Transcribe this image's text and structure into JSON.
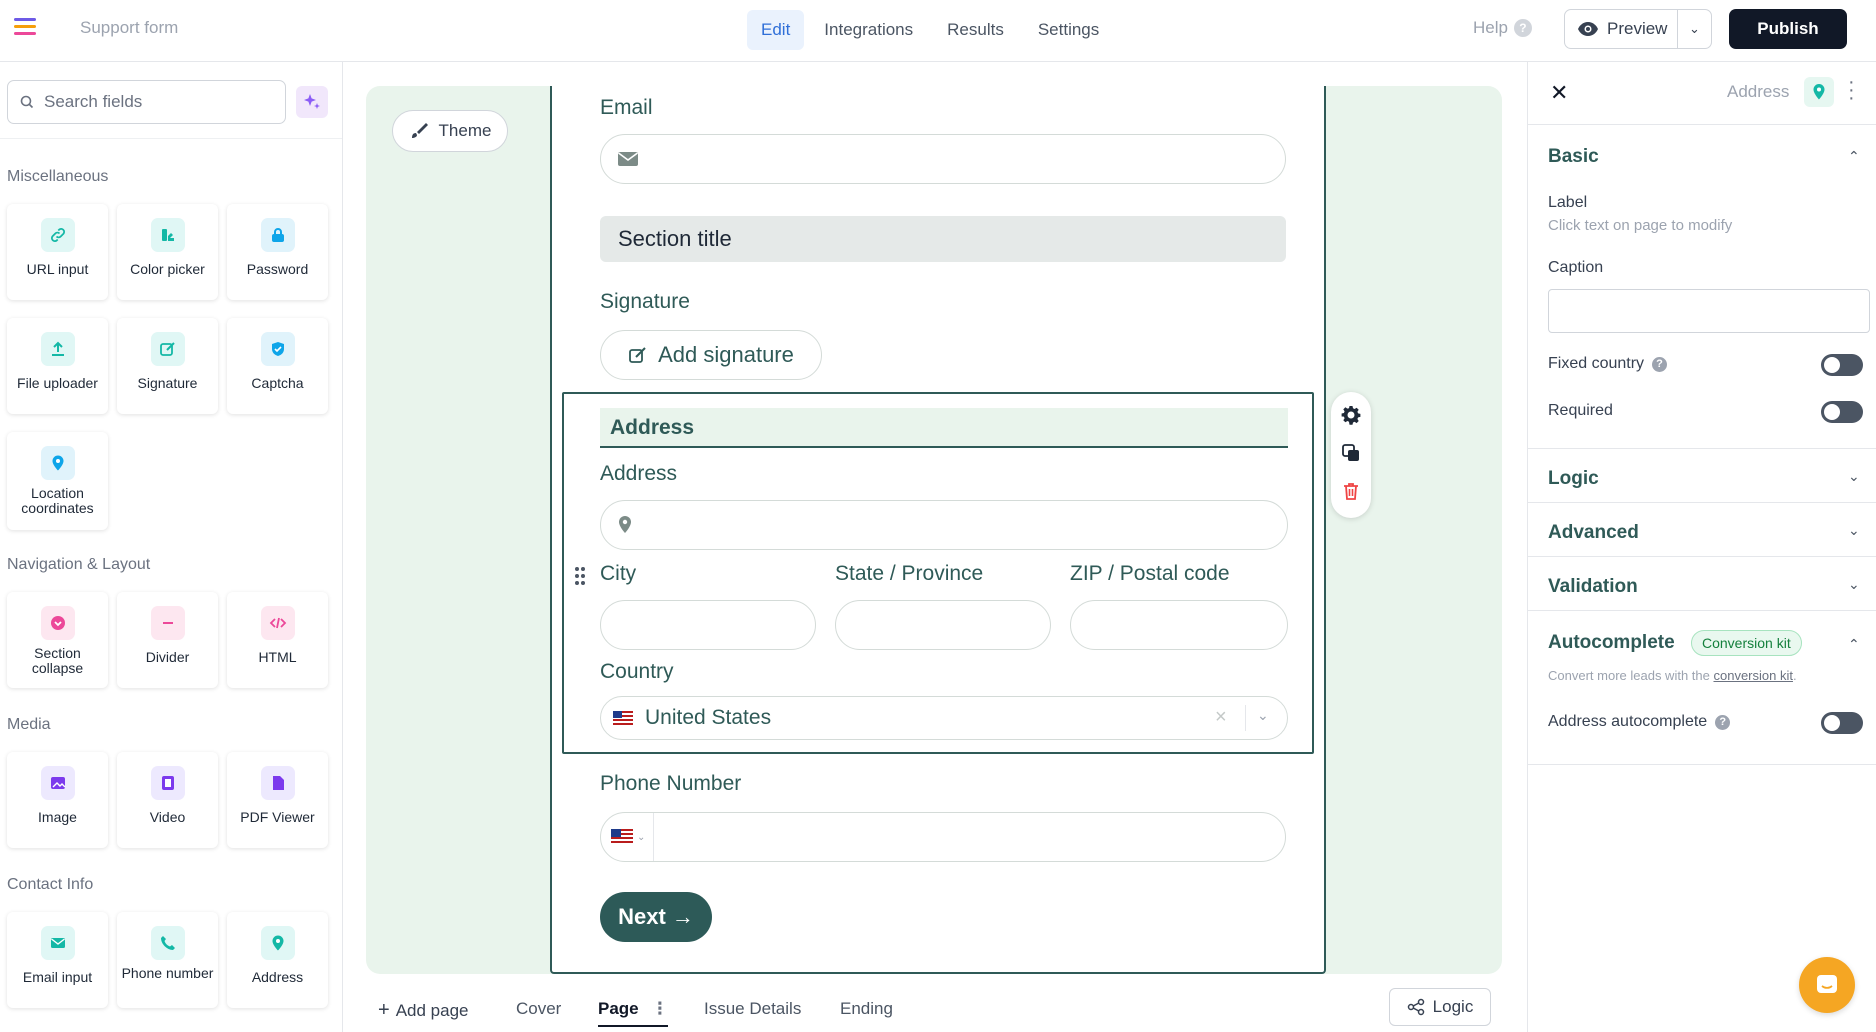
{
  "header": {
    "app_title": "Support form",
    "tabs": [
      {
        "label": "Edit",
        "active": true
      },
      {
        "label": "Integrations"
      },
      {
        "label": "Results"
      },
      {
        "label": "Settings"
      }
    ],
    "help_label": "Help",
    "preview_label": "Preview",
    "publish_label": "Publish"
  },
  "sidebar": {
    "search_placeholder": "Search fields",
    "categories": {
      "misc": "Miscellaneous",
      "nav": "Navigation & Layout",
      "media": "Media",
      "contact": "Contact Info"
    },
    "misc_items": [
      "URL input",
      "Color picker",
      "Password",
      "File uploader",
      "Signature",
      "Captcha",
      "Location coordinates"
    ],
    "nav_items": [
      "Section collapse",
      "Divider",
      "HTML"
    ],
    "media_items": [
      "Image",
      "Video",
      "PDF Viewer"
    ],
    "contact_items": [
      "Email input",
      "Phone number",
      "Address"
    ]
  },
  "canvas": {
    "theme_label": "Theme",
    "email_label": "Email",
    "section_title": "Section title",
    "signature_label": "Signature",
    "add_signature": "Add signature",
    "address_block_title": "Address",
    "address_label": "Address",
    "city_label": "City",
    "state_label": "State / Province",
    "zip_label": "ZIP / Postal code",
    "country_label": "Country",
    "country_value": "United States",
    "phone_label": "Phone Number",
    "next_label": "Next"
  },
  "pagebar": {
    "add_page": "Add page",
    "pages": [
      "Cover",
      "Page",
      "Issue Details",
      "Ending"
    ],
    "active_page": "Page",
    "logic_label": "Logic"
  },
  "right_panel": {
    "field_name": "Address",
    "basic_section": "Basic",
    "label_title": "Label",
    "label_hint": "Click text on page to modify",
    "caption_title": "Caption",
    "caption_value": "",
    "fixed_country": "Fixed country",
    "required": "Required",
    "logic_section": "Logic",
    "advanced_section": "Advanced",
    "validation_section": "Validation",
    "autocomplete_section": "Autocomplete",
    "conversion_badge": "Conversion kit",
    "convert_text": "Convert more leads with the",
    "convert_link": "conversion kit",
    "convert_suffix": ".",
    "address_autocomplete": "Address autocomplete"
  },
  "colors": {
    "brand_teal": "#2f5a57",
    "canvas_bg": "#e9f4ec",
    "publish_bg": "#111827",
    "active_tab": "#2f6fd8",
    "chat_bubble": "#f5a623"
  }
}
